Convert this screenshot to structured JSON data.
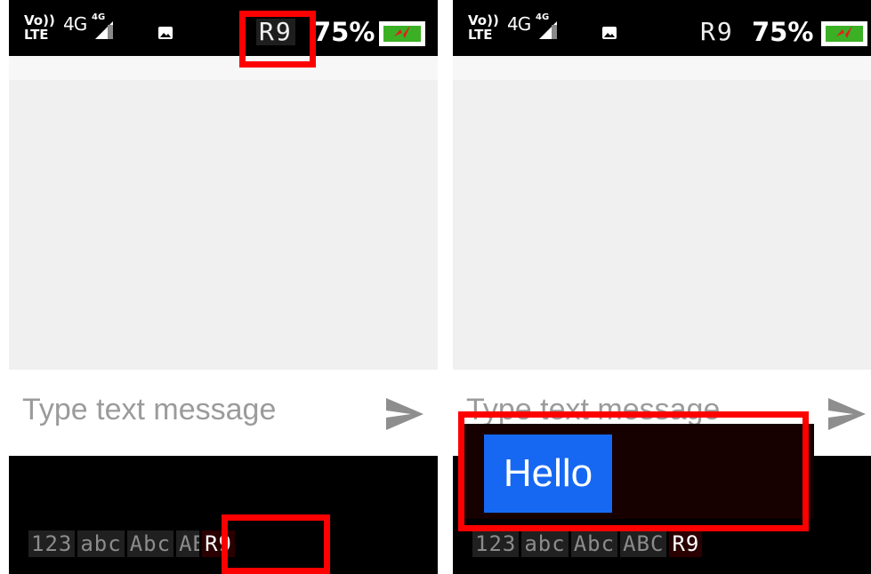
{
  "status_bar": {
    "volte_line1": "Vo))",
    "volte_line2": "LTE",
    "network": "4G",
    "network_small": "4G",
    "battery_percent": "75%"
  },
  "keyboard_modes": [
    "123",
    "abc",
    "Abc",
    "ABC",
    "R9"
  ],
  "left_panel": {
    "input_mode_indicator": "R9",
    "compose_placeholder": "Type text message",
    "active_mode": "R9"
  },
  "right_panel": {
    "input_mode_indicator": "R9",
    "compose_placeholder": "Type text message",
    "suggestion": "Hello",
    "active_mode": "R9"
  },
  "colors": {
    "highlight": "#ff0000",
    "suggestion_bg": "#1668f2",
    "battery_fill": "#3bb024",
    "chat_bg": "#f0f0f0"
  }
}
